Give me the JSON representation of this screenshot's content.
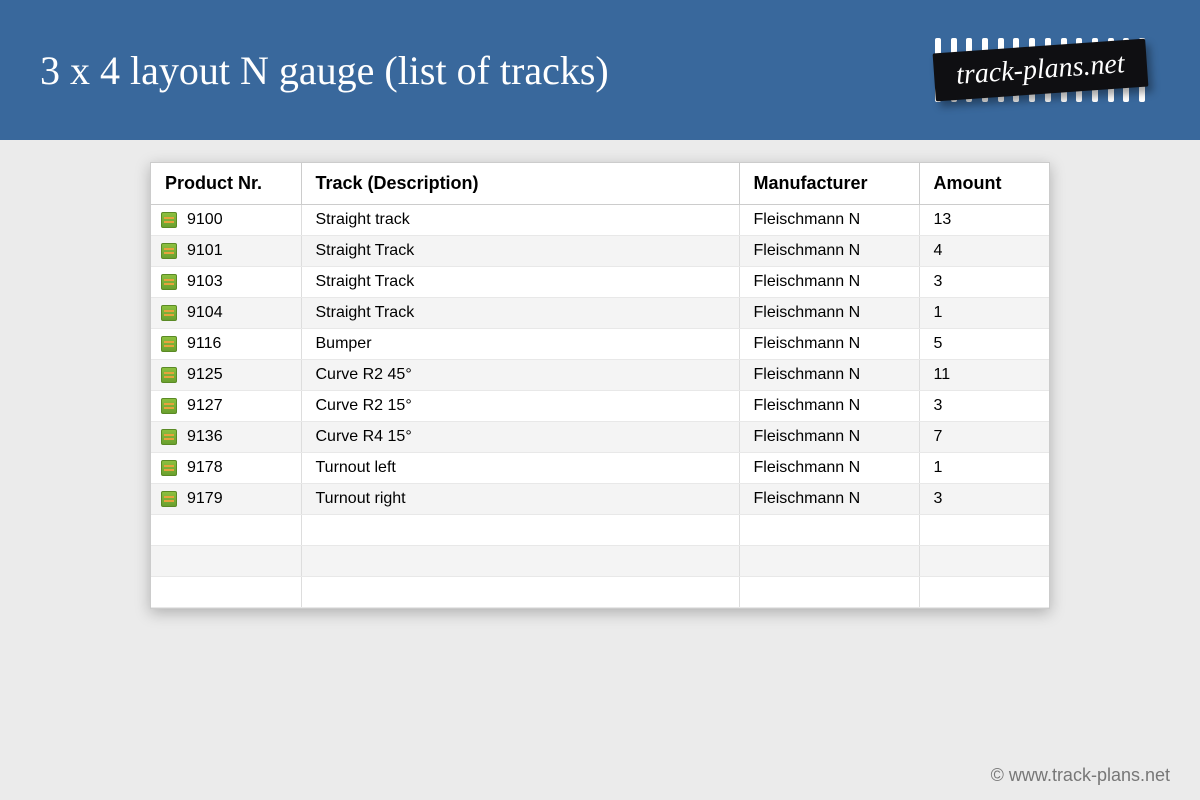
{
  "header": {
    "title": "3 x 4 layout N gauge (list of tracks)",
    "logo_text": "track-plans.net"
  },
  "table": {
    "columns": [
      "Product Nr.",
      "Track (Description)",
      "Manufacturer",
      "Amount"
    ],
    "rows": [
      {
        "product_nr": "9100",
        "description": "Straight track",
        "manufacturer": "Fleischmann N",
        "amount": "13"
      },
      {
        "product_nr": "9101",
        "description": "Straight Track",
        "manufacturer": "Fleischmann N",
        "amount": "4"
      },
      {
        "product_nr": "9103",
        "description": "Straight Track",
        "manufacturer": "Fleischmann N",
        "amount": "3"
      },
      {
        "product_nr": "9104",
        "description": "Straight Track",
        "manufacturer": "Fleischmann N",
        "amount": "1"
      },
      {
        "product_nr": "9116",
        "description": "Bumper",
        "manufacturer": "Fleischmann N",
        "amount": "5"
      },
      {
        "product_nr": "9125",
        "description": "Curve R2 45°",
        "manufacturer": "Fleischmann N",
        "amount": "11"
      },
      {
        "product_nr": "9127",
        "description": "Curve R2 15°",
        "manufacturer": "Fleischmann N",
        "amount": "3"
      },
      {
        "product_nr": "9136",
        "description": "Curve R4 15°",
        "manufacturer": "Fleischmann N",
        "amount": "7"
      },
      {
        "product_nr": "9178",
        "description": "Turnout left",
        "manufacturer": "Fleischmann N",
        "amount": "1"
      },
      {
        "product_nr": "9179",
        "description": "Turnout right",
        "manufacturer": "Fleischmann N",
        "amount": "3"
      }
    ],
    "trailing_blank_rows": 3
  },
  "footer": {
    "copyright": "© www.track-plans.net"
  }
}
